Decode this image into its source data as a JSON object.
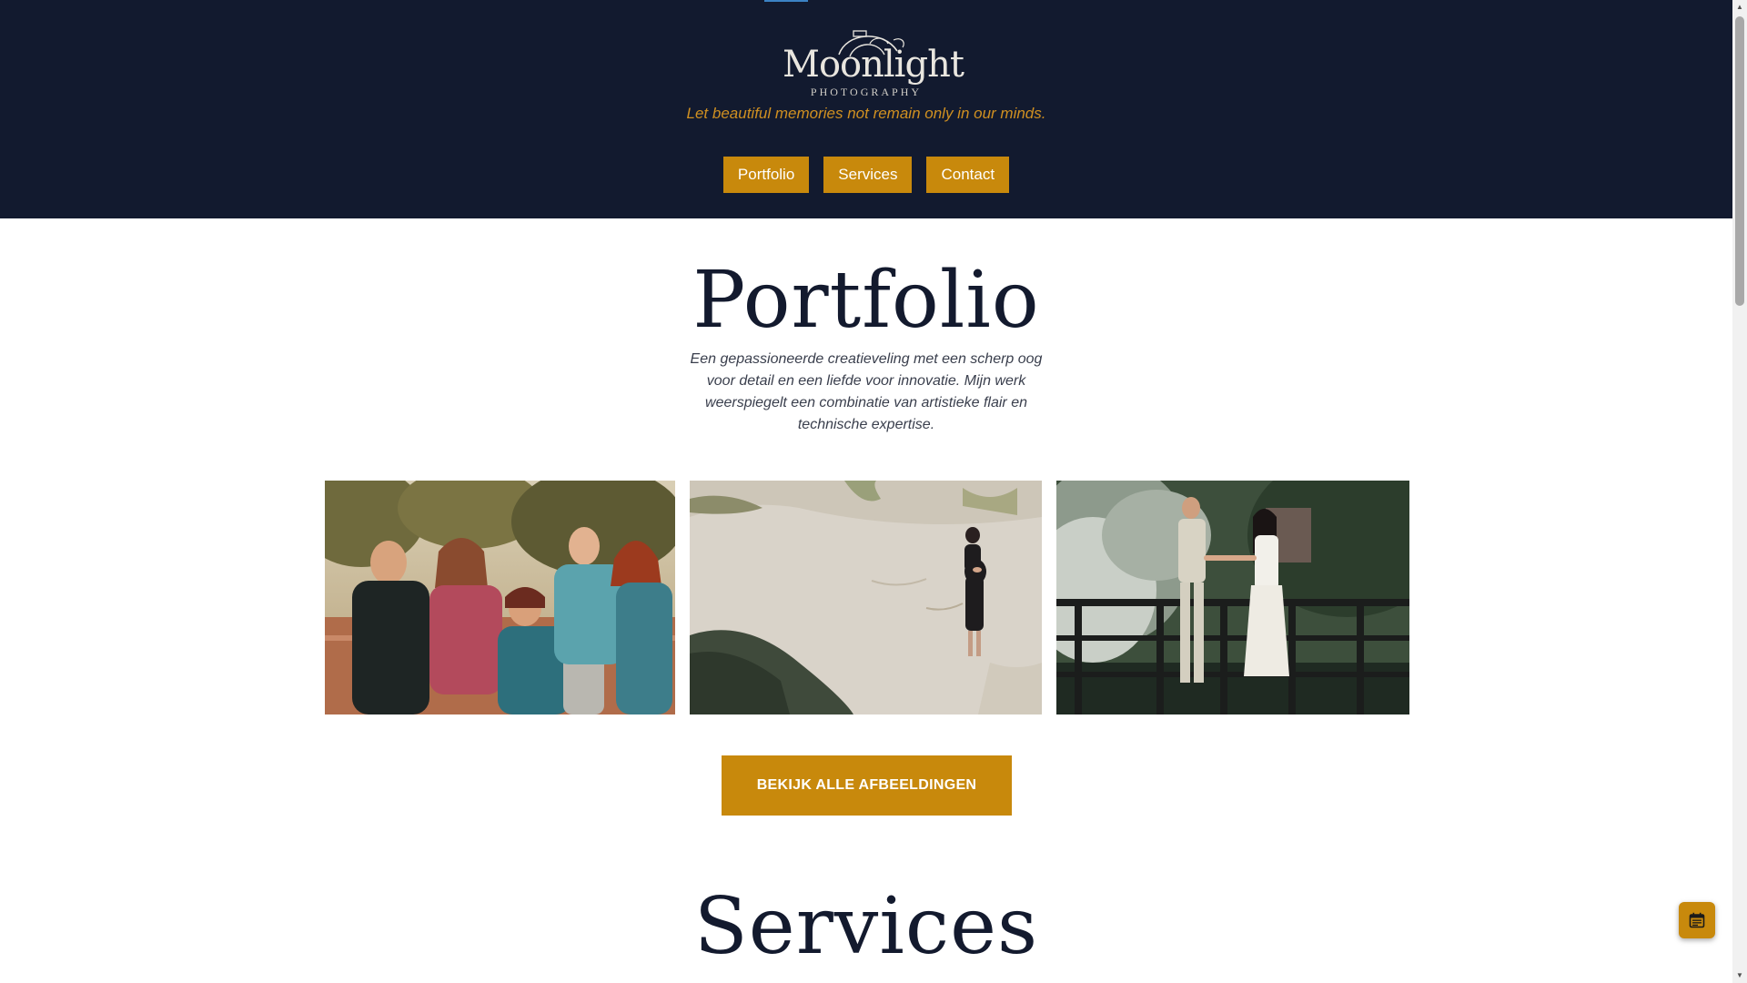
{
  "brand": {
    "logo_word": "Moonlight",
    "logo_sub": "PHOTOGRAPHY",
    "tagline": "Let beautiful memories not remain only in our minds."
  },
  "nav": {
    "items": [
      {
        "label": "Portfolio"
      },
      {
        "label": "Services"
      },
      {
        "label": "Contact"
      }
    ]
  },
  "portfolio": {
    "title": "Portfolio",
    "intro": "Een gepassioneerde creatieveling met een scherp oog voor detail en een liefde voor innovatie. Mijn werk weerspiegelt een combinatie van artistieke flair en technische expertise.",
    "cta_label": "BEKIJK ALLE AFBEELDINGEN"
  },
  "services": {
    "title": "Services"
  },
  "floating": {
    "icon": "calendar-icon"
  },
  "colors": {
    "header_bg": "#121a2f",
    "accent": "#c8890c",
    "tagline": "#d09021",
    "heading": "#131a2e"
  }
}
